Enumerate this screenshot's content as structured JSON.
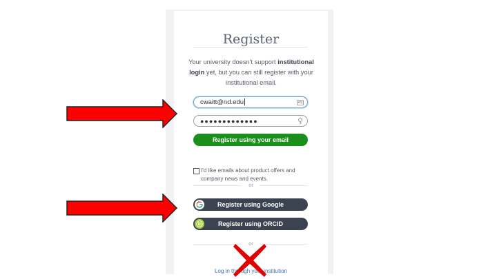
{
  "form": {
    "title": "Register",
    "info_prefix": "Your university doesn't support ",
    "info_bold": "institutional login",
    "info_suffix": " yet, but you can still register with your institutional email.",
    "email_value": "cwaitt@nd.edu",
    "password_value": "●●●●●●●●●●●●●",
    "register_email_label": "Register using your email",
    "checkbox_label": "I'd like emails about product offers and company news and events.",
    "checkbox_checked": false,
    "or_1": "or",
    "google_label": "Register using Google",
    "orcid_label": "Register using ORCID",
    "or_2": "or",
    "institution_link": "Log in through your institution"
  },
  "icons": {
    "email_field_icon": "contact-card-icon",
    "password_field_icon": "key-icon",
    "google_icon": "google-logo-icon",
    "orcid_icon": "orcid-logo-icon"
  },
  "annotations": {
    "arrow_color": "#ff0000",
    "x_mark_color": "#e00000"
  },
  "colors": {
    "green_button": "#1b8f1b",
    "dark_button": "#3c4350",
    "link": "#3f72b6"
  }
}
